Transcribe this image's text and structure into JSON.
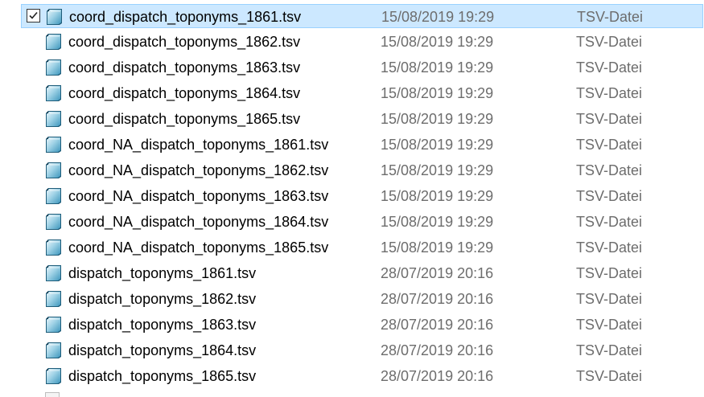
{
  "files": [
    {
      "name": "coord_dispatch_toponyms_1861.tsv",
      "date": "15/08/2019 19:29",
      "type": "TSV-Datei",
      "selected": true,
      "icon": "tsv-file-icon"
    },
    {
      "name": "coord_dispatch_toponyms_1862.tsv",
      "date": "15/08/2019 19:29",
      "type": "TSV-Datei",
      "selected": false,
      "icon": "tsv-file-icon"
    },
    {
      "name": "coord_dispatch_toponyms_1863.tsv",
      "date": "15/08/2019 19:29",
      "type": "TSV-Datei",
      "selected": false,
      "icon": "tsv-file-icon"
    },
    {
      "name": "coord_dispatch_toponyms_1864.tsv",
      "date": "15/08/2019 19:29",
      "type": "TSV-Datei",
      "selected": false,
      "icon": "tsv-file-icon"
    },
    {
      "name": "coord_dispatch_toponyms_1865.tsv",
      "date": "15/08/2019 19:29",
      "type": "TSV-Datei",
      "selected": false,
      "icon": "tsv-file-icon"
    },
    {
      "name": "coord_NA_dispatch_toponyms_1861.tsv",
      "date": "15/08/2019 19:29",
      "type": "TSV-Datei",
      "selected": false,
      "icon": "tsv-file-icon"
    },
    {
      "name": "coord_NA_dispatch_toponyms_1862.tsv",
      "date": "15/08/2019 19:29",
      "type": "TSV-Datei",
      "selected": false,
      "icon": "tsv-file-icon"
    },
    {
      "name": "coord_NA_dispatch_toponyms_1863.tsv",
      "date": "15/08/2019 19:29",
      "type": "TSV-Datei",
      "selected": false,
      "icon": "tsv-file-icon"
    },
    {
      "name": "coord_NA_dispatch_toponyms_1864.tsv",
      "date": "15/08/2019 19:29",
      "type": "TSV-Datei",
      "selected": false,
      "icon": "tsv-file-icon"
    },
    {
      "name": "coord_NA_dispatch_toponyms_1865.tsv",
      "date": "15/08/2019 19:29",
      "type": "TSV-Datei",
      "selected": false,
      "icon": "tsv-file-icon"
    },
    {
      "name": "dispatch_toponyms_1861.tsv",
      "date": "28/07/2019 20:16",
      "type": "TSV-Datei",
      "selected": false,
      "icon": "tsv-file-icon"
    },
    {
      "name": "dispatch_toponyms_1862.tsv",
      "date": "28/07/2019 20:16",
      "type": "TSV-Datei",
      "selected": false,
      "icon": "tsv-file-icon"
    },
    {
      "name": "dispatch_toponyms_1863.tsv",
      "date": "28/07/2019 20:16",
      "type": "TSV-Datei",
      "selected": false,
      "icon": "tsv-file-icon"
    },
    {
      "name": "dispatch_toponyms_1864.tsv",
      "date": "28/07/2019 20:16",
      "type": "TSV-Datei",
      "selected": false,
      "icon": "tsv-file-icon"
    },
    {
      "name": "dispatch_toponyms_1865.tsv",
      "date": "28/07/2019 20:16",
      "type": "TSV-Datei",
      "selected": false,
      "icon": "tsv-file-icon"
    }
  ],
  "colors": {
    "selection_background": "#cce8ff",
    "selection_border": "#99d1ff",
    "secondary_text": "#6d6d6d"
  }
}
